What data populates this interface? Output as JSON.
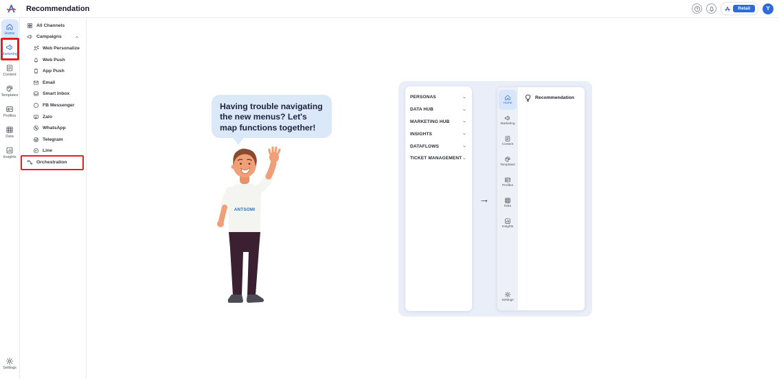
{
  "topbar": {
    "title": "Recommendation",
    "workspace_badge": "Retail",
    "avatar_initial": "Y",
    "icons": [
      "antsomi-logo",
      "help-circle",
      "notification-bell"
    ]
  },
  "left_rail": {
    "items": [
      {
        "label": "Home",
        "icon": "home",
        "active": true,
        "highlighted": false
      },
      {
        "label": "Marketing",
        "icon": "megaphone",
        "active": false,
        "highlighted": true
      },
      {
        "label": "Content",
        "icon": "document",
        "active": false,
        "highlighted": false
      },
      {
        "label": "Templates",
        "icon": "palette",
        "active": false,
        "highlighted": false
      },
      {
        "label": "Profiles",
        "icon": "id-card",
        "active": false,
        "highlighted": false
      },
      {
        "label": "Data",
        "icon": "grid-table",
        "active": false,
        "highlighted": false
      },
      {
        "label": "Insights",
        "icon": "chart-square",
        "active": false,
        "highlighted": false
      }
    ],
    "bottom": {
      "label": "Settings",
      "icon": "gear"
    }
  },
  "submenu": {
    "items": [
      {
        "label": "All Channels",
        "icon": "grid",
        "indent": 0
      },
      {
        "label": "Campaigns",
        "icon": "megaphone",
        "indent": 0,
        "expanded": true
      },
      {
        "label": "Web Personalize",
        "icon": "person-share",
        "indent": 1
      },
      {
        "label": "Web Push",
        "icon": "bell",
        "indent": 1
      },
      {
        "label": "App Push",
        "icon": "smartphone",
        "indent": 1
      },
      {
        "label": "Email",
        "icon": "envelope",
        "indent": 1
      },
      {
        "label": "Smart Inbox",
        "icon": "inbox",
        "indent": 1
      },
      {
        "label": "FB Messenger",
        "icon": "messenger",
        "indent": 1
      },
      {
        "label": "Zalo",
        "icon": "zalo-bubble",
        "indent": 1
      },
      {
        "label": "WhatsApp",
        "icon": "whatsapp",
        "indent": 1
      },
      {
        "label": "Telegram",
        "icon": "telegram",
        "indent": 1
      },
      {
        "label": "Line",
        "icon": "line-bubble",
        "indent": 1
      },
      {
        "label": "Orchestration",
        "icon": "flow-branch",
        "indent": 0,
        "highlighted": true
      }
    ]
  },
  "main": {
    "bubble_text": "Having trouble navigating the new menus? Let's map functions together!",
    "character": {
      "shirt_text": "ANTSOMI"
    },
    "mapping_widget": {
      "old_menu_items": [
        "PERSONAS",
        "DATA HUB",
        "MARKETING HUB",
        "INSIGHTS",
        "DATAFLOWS",
        "TICKET MANAGEMENT"
      ],
      "arrow": "→",
      "new_menu": {
        "rail": [
          "Home",
          "Marketing",
          "Content",
          "Templates",
          "Profiles",
          "Data",
          "Insights"
        ],
        "bottom": "Settings",
        "content_title": "Recommendation",
        "content_icon": "lightbulb-sparkle"
      }
    }
  },
  "colors": {
    "accent_blue": "#2e6bd6",
    "highlight_red": "#e0201d",
    "bubble_bg": "#dbe8f8",
    "container_bg": "#e9eef8",
    "active_item_bg": "#d9e7fb"
  }
}
